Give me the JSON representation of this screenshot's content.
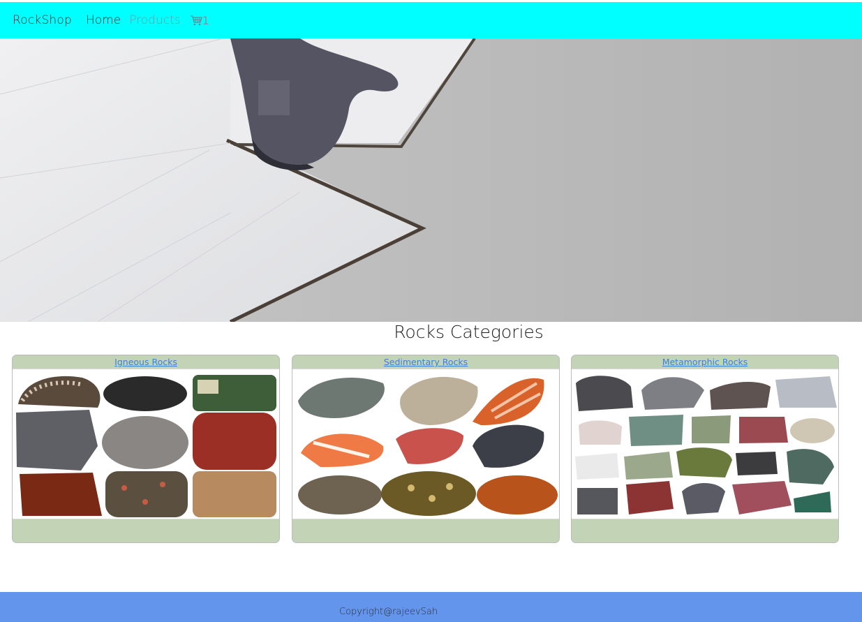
{
  "nav": {
    "brand": "RockShop",
    "links": [
      {
        "label": "Home"
      },
      {
        "label": "Products"
      }
    ],
    "cart_count": "1",
    "bg_color": "#00ffff"
  },
  "main": {
    "section_title": "Rocks Categories",
    "categories": [
      {
        "title": "Igneous Rocks"
      },
      {
        "title": "Sedimentary Rocks"
      },
      {
        "title": "Metamorphic Rocks"
      }
    ],
    "card_color": "#c3d3b6"
  },
  "footer": {
    "copyright": "Copyright@rajeevSah",
    "bg_color": "#6495ed"
  }
}
